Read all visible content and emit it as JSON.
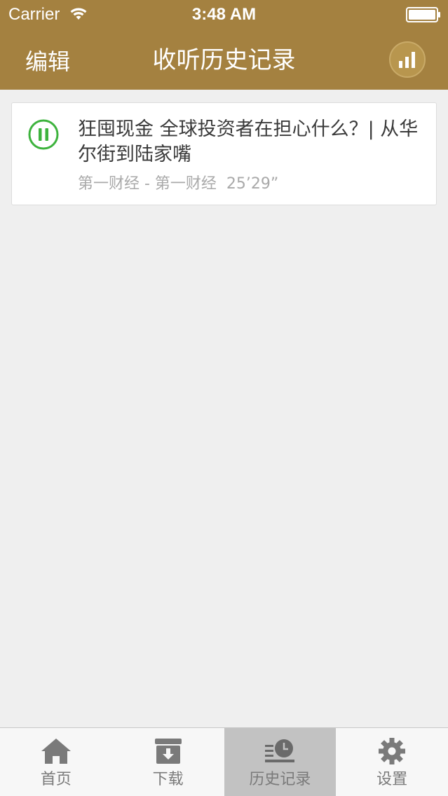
{
  "status_bar": {
    "carrier": "Carrier",
    "time": "3:48 AM"
  },
  "nav": {
    "edit_label": "编辑",
    "title": "收听历史记录",
    "stats_icon": "bar-chart-icon"
  },
  "history": {
    "items": [
      {
        "title": "狂囤现金 全球投资者在担心什么？| 从华尔街到陆家嘴",
        "meta": "第一财经 - 第一财经  25’29”",
        "state_icon": "pause-icon"
      }
    ]
  },
  "tabs": [
    {
      "label": "首页",
      "icon": "home-icon",
      "active": false
    },
    {
      "label": "下载",
      "icon": "download-icon",
      "active": false
    },
    {
      "label": "历史记录",
      "icon": "history-icon",
      "active": true
    },
    {
      "label": "设置",
      "icon": "settings-icon",
      "active": false
    }
  ],
  "colors": {
    "nav_background": "#a48140",
    "play_state": "#3db33d",
    "page_background": "#efefef",
    "active_tab": "#c2c2c2"
  }
}
